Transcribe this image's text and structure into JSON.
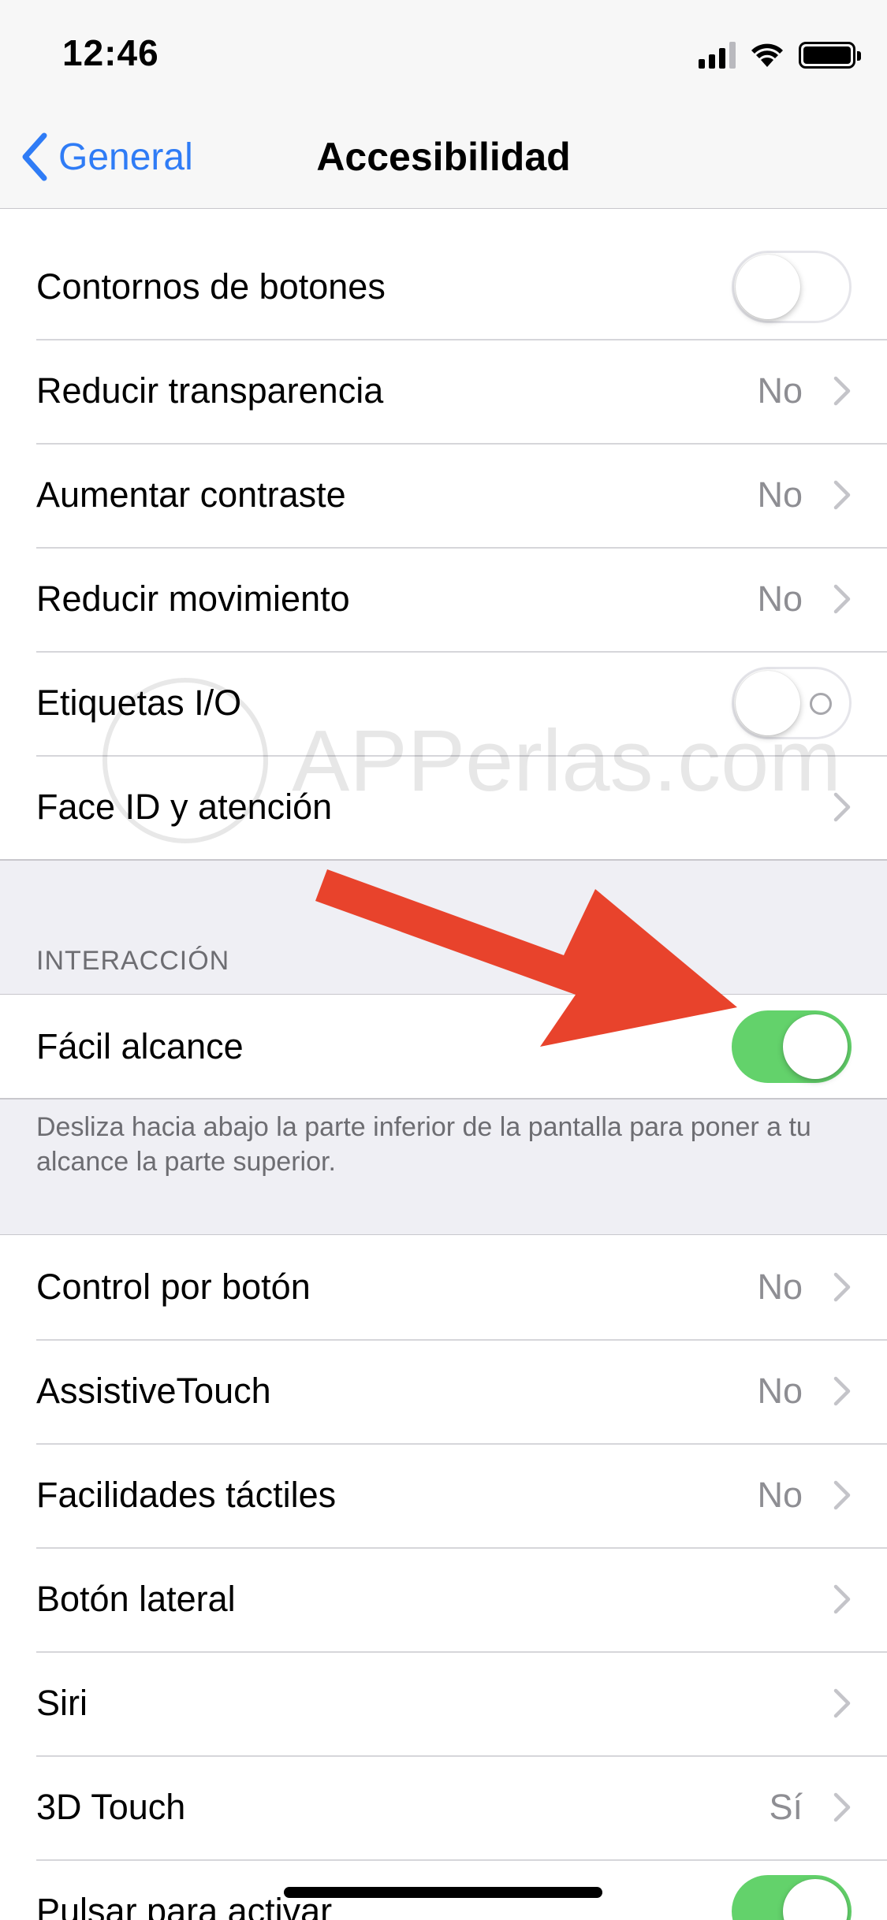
{
  "status_bar": {
    "time": "12:46",
    "icons": [
      "signal-icon",
      "wifi-icon",
      "battery-icon"
    ]
  },
  "nav": {
    "back_label": "General",
    "title": "Accesibilidad"
  },
  "colors": {
    "accent": "#2f7cf6",
    "switch_on": "#63d26b",
    "arrow": "#e8432c",
    "secondary_text": "#8e8e93",
    "background": "#efeff4"
  },
  "group1": {
    "rows": [
      {
        "label": "Contornos de botones",
        "control": "switch",
        "on": false
      },
      {
        "label": "Reducir transparencia",
        "value": "No",
        "control": "chevron"
      },
      {
        "label": "Aumentar contraste",
        "value": "No",
        "control": "chevron"
      },
      {
        "label": "Reducir movimiento",
        "value": "No",
        "control": "chevron"
      },
      {
        "label": "Etiquetas I/O",
        "control": "switch",
        "on": false
      },
      {
        "label": "Face ID y atención",
        "control": "chevron"
      }
    ]
  },
  "interaction": {
    "header": "INTERACCIÓN",
    "rows": [
      {
        "label": "Fácil alcance",
        "control": "switch",
        "on": true
      }
    ],
    "footer": "Desliza hacia abajo la parte inferior de la pantalla para poner a tu alcance la parte superior."
  },
  "group2": {
    "rows": [
      {
        "label": "Control por botón",
        "value": "No",
        "control": "chevron"
      },
      {
        "label": "AssistiveTouch",
        "value": "No",
        "control": "chevron"
      },
      {
        "label": "Facilidades táctiles",
        "value": "No",
        "control": "chevron"
      },
      {
        "label": "Botón lateral",
        "control": "chevron"
      },
      {
        "label": "Siri",
        "control": "chevron"
      },
      {
        "label": "3D Touch",
        "value": "Sí",
        "control": "chevron"
      },
      {
        "label": "Pulsar para activar",
        "control": "switch",
        "on": true
      }
    ]
  },
  "watermark": {
    "text": "APPerlas.com"
  }
}
